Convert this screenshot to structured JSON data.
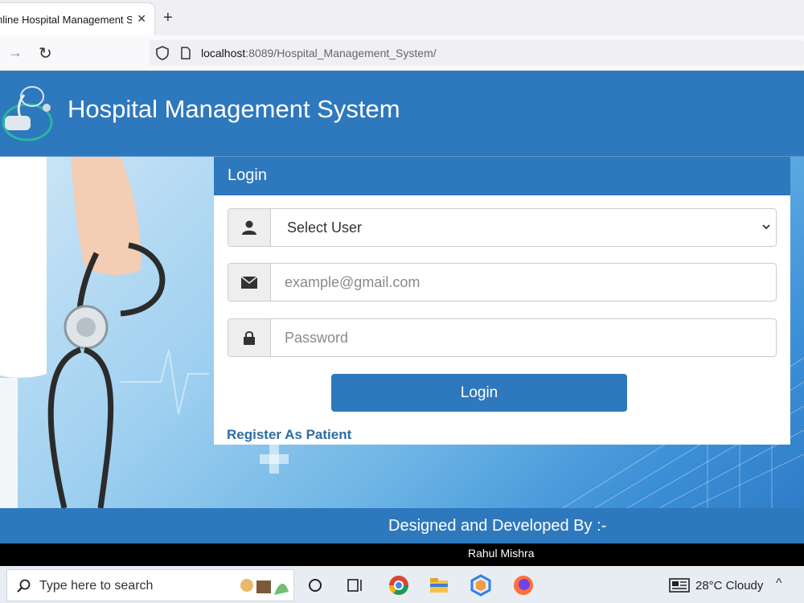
{
  "browser": {
    "tab_title": "nline Hospital Management Sy",
    "tab_close": "✕",
    "new_tab": "+",
    "nav_forward": "→",
    "nav_reload": "↻",
    "url_host": "localhost",
    "url_rest": ":8089/Hospital_Management_System/"
  },
  "header": {
    "title": "Hospital Management System"
  },
  "login": {
    "heading": "Login",
    "user_select": "Select User",
    "email_placeholder": "example@gmail.com",
    "password_placeholder": "Password",
    "button": "Login",
    "register_link": "Register As Patient"
  },
  "footer": {
    "designed_by": "Designed and Developed By :-",
    "author": "Rahul Mishra"
  },
  "taskbar": {
    "search_placeholder": "Type here to search",
    "weather": "28°C  Cloudy",
    "tray_up": "^"
  },
  "colors": {
    "brand_blue": "#2e78bd",
    "link_blue": "#2e6da4"
  }
}
